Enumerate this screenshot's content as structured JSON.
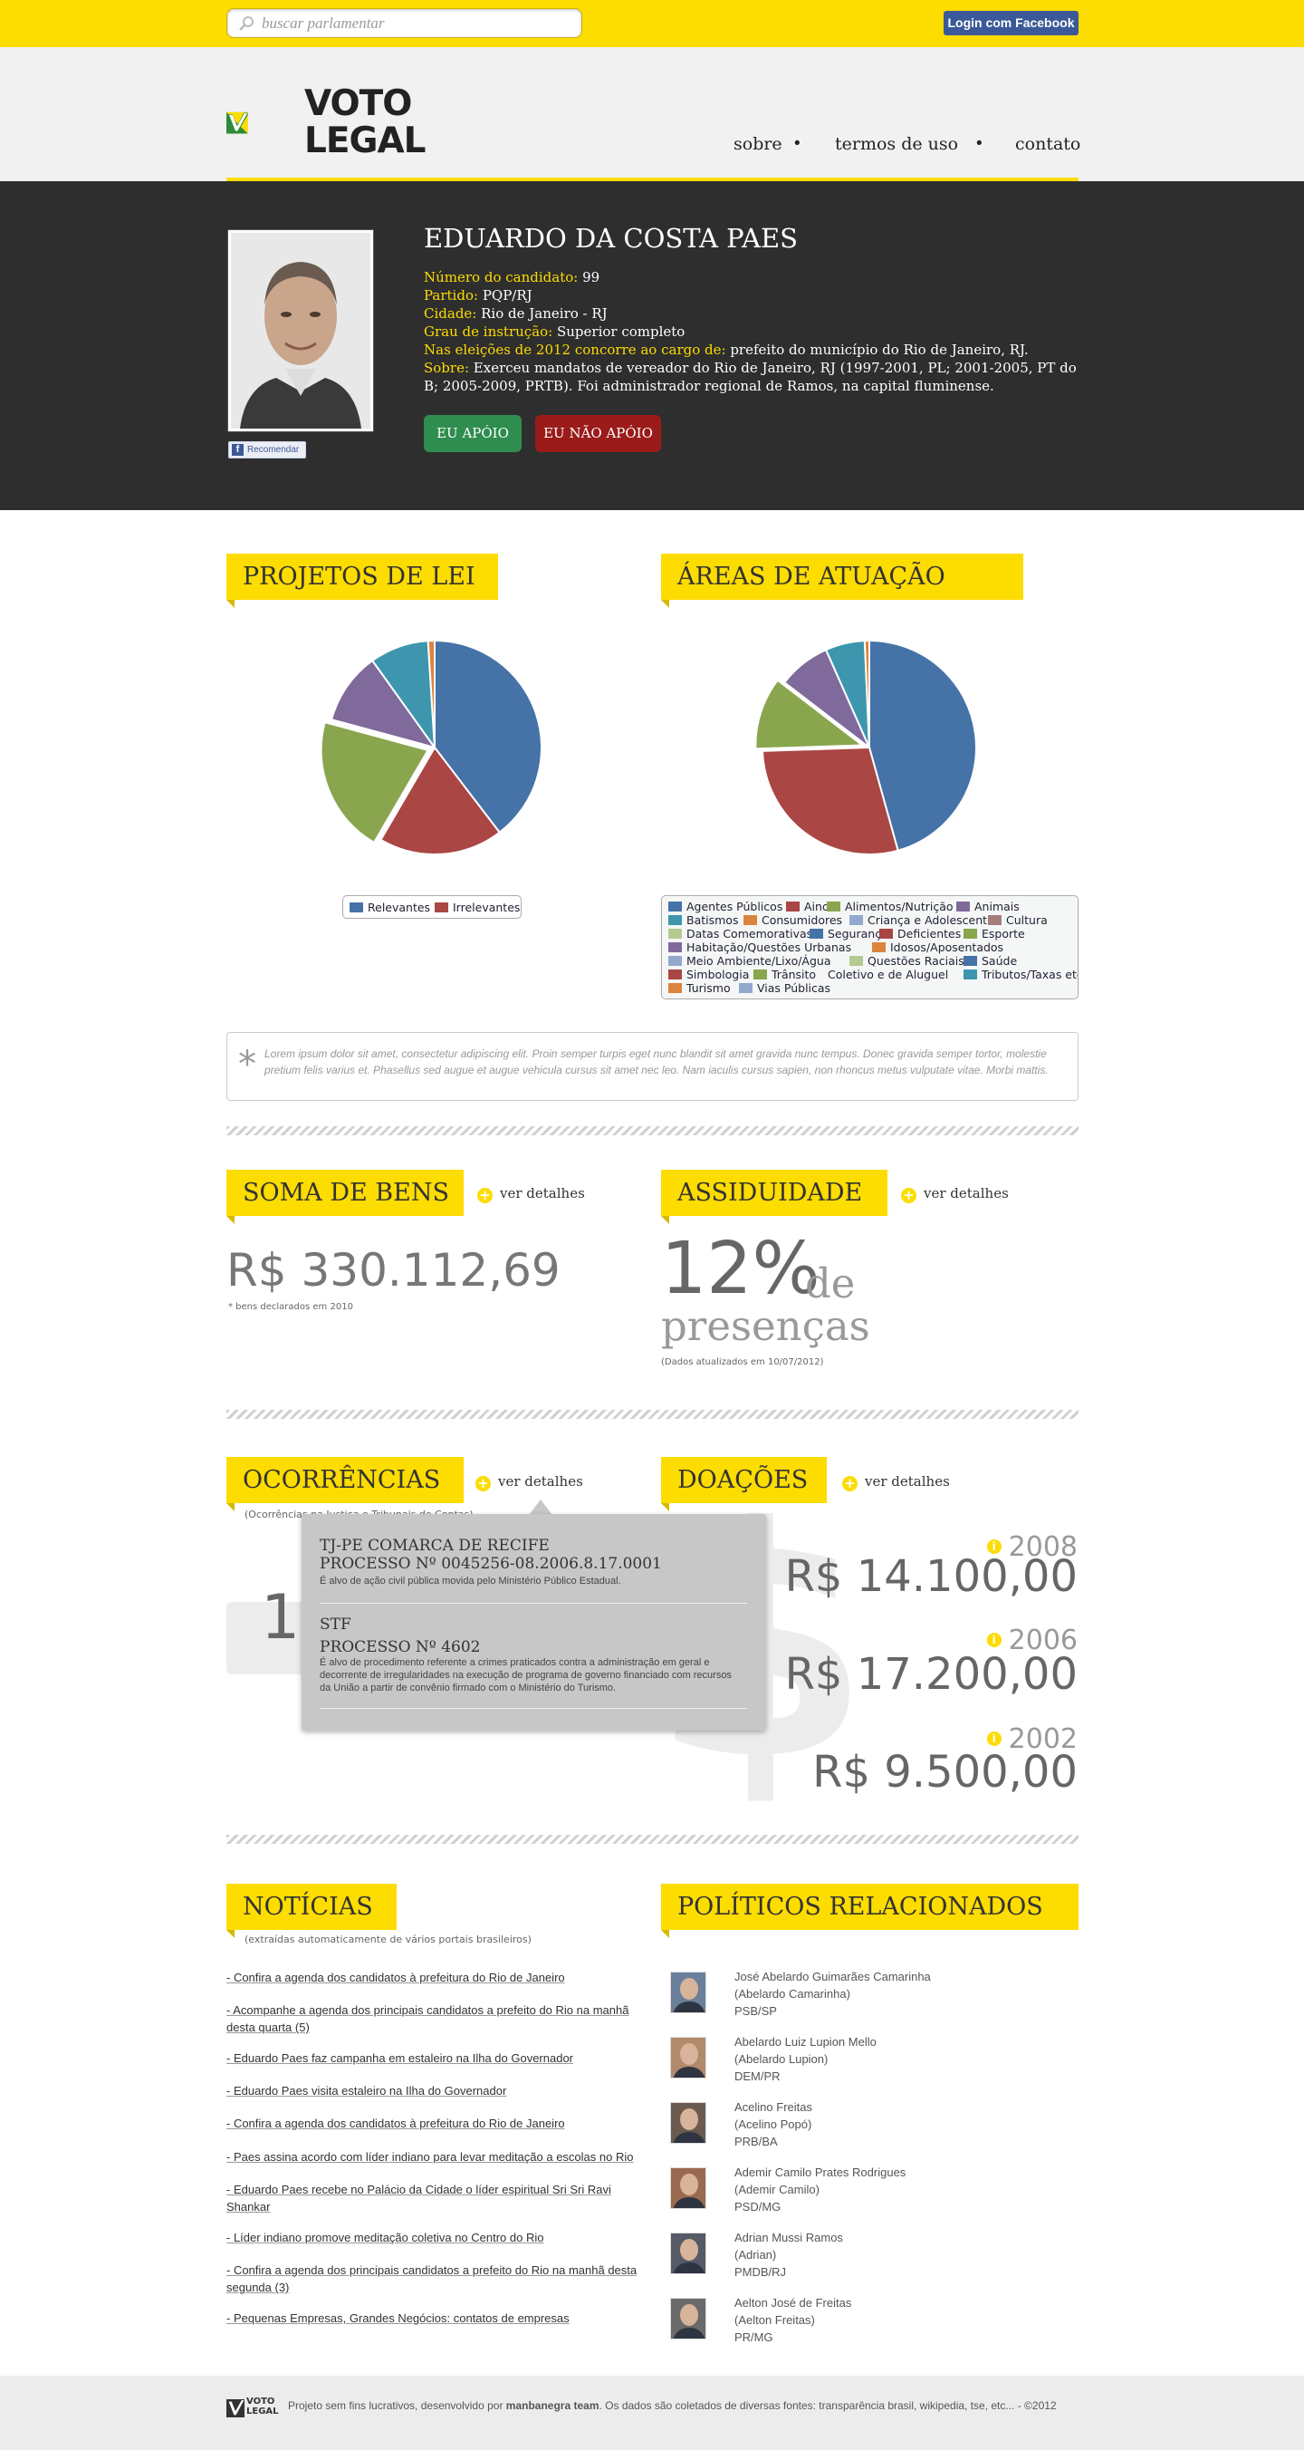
{
  "topbar": {
    "search_placeholder": "buscar parlamentar",
    "login_label": "Login com Facebook"
  },
  "header": {
    "logo_line1": "VOTO",
    "logo_line2": "LEGAL",
    "nav": [
      "sobre",
      "termos de uso",
      "contato"
    ]
  },
  "profile": {
    "name": "EDUARDO DA COSTA PAES",
    "recommend_label": "Recomendar",
    "fields": [
      {
        "label": "Número do candidato:",
        "value": "99"
      },
      {
        "label": "Partido:",
        "value": "PQP/RJ"
      },
      {
        "label": "Cidade:",
        "value": "Rio de Janeiro - RJ"
      },
      {
        "label": "Grau de instrução:",
        "value": "Superior completo"
      },
      {
        "label": "Nas eleições de 2012 concorre ao cargo de:",
        "value": "prefeito do município do Rio de Janeiro, RJ."
      },
      {
        "label": "Sobre:",
        "value": "Exerceu mandatos de vereador do Rio de Janeiro, RJ (1997-2001, PL; 2001-2005, PT do B; 2005-2009, PRTB). Foi administrador regional de Ramos, na capital fluminense."
      }
    ],
    "apoio_label": "EU APÓIO",
    "nao_apoio_label": "EU NÃO APÓIO"
  },
  "projetos": {
    "title": "PROJETOS DE LEI",
    "legend": [
      {
        "label": "Relevantes",
        "color": "#4572a7"
      },
      {
        "label": "Irrelevantes",
        "color": "#aa4643"
      }
    ]
  },
  "areas": {
    "title": "ÁREAS DE ATUAÇÃO",
    "legend": [
      {
        "label": "Agentes Públicos",
        "color": "#4572a7"
      },
      {
        "label": "Ainda",
        "color": "#aa4643"
      },
      {
        "label": "Alimentos/Nutrição",
        "color": "#89a54e"
      },
      {
        "label": "Animais",
        "color": "#80699b"
      },
      {
        "label": "Batismos",
        "color": "#3d96ae"
      },
      {
        "label": "Consumidores",
        "color": "#db843d"
      },
      {
        "label": "Criança e Adolescente",
        "color": "#92a8cd"
      },
      {
        "label": "Cultura",
        "color": "#a47d7c"
      },
      {
        "label": "Datas Comemorativas",
        "color": "#b5ca92"
      },
      {
        "label": "Segurança",
        "color": "#4572a7"
      },
      {
        "label": "Deficientes",
        "color": "#aa4643"
      },
      {
        "label": "Esporte",
        "color": "#89a54e"
      },
      {
        "label": "Habitação/Questões Urbanas",
        "color": "#80699b"
      },
      {
        "label": "Idosos/Aposentados",
        "color": "#db843d"
      },
      {
        "label": "Meio Ambiente/Lixo/Água",
        "color": "#92a8cd"
      },
      {
        "label": "Questões Raciais",
        "color": "#b5ca92"
      },
      {
        "label": "Saúde",
        "color": "#4572a7"
      },
      {
        "label": "Simbologia",
        "color": "#aa4643"
      },
      {
        "label": "Trânsito",
        "color": "#89a54e"
      },
      {
        "label": "Coletivo e de Aluguel",
        "color": "#ffffff"
      },
      {
        "label": "Tributos/Taxas etc.",
        "color": "#3d96ae"
      },
      {
        "label": "Turismo",
        "color": "#db843d"
      },
      {
        "label": "Vias Públicas",
        "color": "#92a8cd"
      }
    ]
  },
  "chart_data": [
    {
      "type": "pie",
      "title": "PROJETOS DE LEI",
      "slices": [
        {
          "label": "Relevantes",
          "value": 40,
          "color": "#4572a7"
        },
        {
          "label": "",
          "value": 19,
          "color": "#aa4643"
        },
        {
          "label": "",
          "value": 21,
          "color": "#89a54e"
        },
        {
          "label": "",
          "value": 11,
          "color": "#80699b"
        },
        {
          "label": "",
          "value": 9,
          "color": "#3d96ae"
        },
        {
          "label": "",
          "value": 1,
          "color": "#db843d"
        }
      ]
    },
    {
      "type": "pie",
      "title": "ÁREAS DE ATUAÇÃO",
      "slices": [
        {
          "label": "Agentes Públicos",
          "value": 46,
          "color": "#4572a7"
        },
        {
          "label": "",
          "value": 29,
          "color": "#aa4643"
        },
        {
          "label": "",
          "value": 11,
          "color": "#89a54e"
        },
        {
          "label": "",
          "value": 8,
          "color": "#80699b"
        },
        {
          "label": "",
          "value": 6,
          "color": "#3d96ae"
        },
        {
          "label": "",
          "value": 0.7,
          "color": "#db843d"
        }
      ]
    }
  ],
  "lorem": "Lorem ipsum dolor sit amet, consectetur adipiscing elit. Proin semper turpis eget nunc blandit sit amet gravida nunc tempus. Donec gravida semper tortor, molestie pretium felis varius et. Phasellus sed augue et augue vehicula cursus sit amet nec leo. Nam iaculis cursus sapien, non rhoncus metus vulputate vitae. Morbi mattis.",
  "bens": {
    "title": "SOMA DE BENS",
    "link": "ver detalhes",
    "value": "R$ 330.112,69",
    "note": "* bens declarados em 2010"
  },
  "assiduidade": {
    "title": "ASSIDUIDADE",
    "link": "ver detalhes",
    "percent": "12%",
    "de": "de",
    "presencas": "presenças",
    "note": "(Dados atualizados em 10/07/2012)"
  },
  "ocorrencias": {
    "title": "OCORRÊNCIAS",
    "link": "ver detalhes",
    "subtitle": "(Ocorrências na Justiça e Tribunais de Contas)",
    "count": "15",
    "items": [
      {
        "court": "TJ-PE COMARCA DE RECIFE",
        "process": "PROCESSO Nº 0045256-08.2006.8.17.0001",
        "desc": "É alvo de ação civil pública movida pelo Ministério Público Estadual."
      },
      {
        "court": "STF",
        "process": "PROCESSO Nº 4602",
        "desc": "É alvo de procedimento referente a crimes praticados contra a administração em geral e decorrente de irregularidades na execução de programa de governo financiado com recursos da União a partir de convênio firmado com o Ministério do Turismo."
      }
    ]
  },
  "doacoes": {
    "title": "DOAÇÕES",
    "link": "ver detalhes",
    "entries": [
      {
        "year": "2008",
        "amount": "R$ 14.100,00"
      },
      {
        "year": "2006",
        "amount": "R$ 17.200,00"
      },
      {
        "year": "2002",
        "amount": "R$ 9.500,00"
      }
    ]
  },
  "noticias": {
    "title": "NOTÍCIAS",
    "subtitle": "(extraídas automaticamente de vários portais brasileiros)",
    "items": [
      "- Confira a agenda dos candidatos à prefeitura do Rio de Janeiro",
      "- Acompanhe a agenda dos principais candidatos a prefeito do Rio na manhã desta quarta (5)",
      "- Eduardo Paes faz campanha em estaleiro na Ilha do Governador",
      "- Eduardo Paes visita estaleiro na Ilha do Governador",
      "- Confira a agenda dos candidatos à prefeitura do Rio de Janeiro",
      "- Paes assina acordo com líder indiano para levar meditação a escolas no Rio",
      "- Eduardo Paes recebe no Palácio da Cidade o líder espiritual Sri Sri Ravi Shankar",
      "- Líder indiano promove meditação coletiva no Centro do Rio",
      "- Confira a agenda dos principais candidatos a prefeito do Rio na manhã desta segunda (3)",
      "- Pequenas Empresas, Grandes Negócios: contatos de empresas"
    ]
  },
  "relacionados": {
    "title": "POLÍTICOS RELACIONADOS",
    "items": [
      {
        "name": "José Abelardo Guimarães Camarinha",
        "alias": "(Abelardo Camarinha)",
        "party": "PSB/SP"
      },
      {
        "name": "Abelardo Luiz Lupion Mello",
        "alias": "(Abelardo Lupion)",
        "party": "DEM/PR"
      },
      {
        "name": "Acelino Freitas",
        "alias": "(Acelino Popó)",
        "party": "PRB/BA"
      },
      {
        "name": "Ademir Camilo Prates Rodrigues",
        "alias": "(Ademir Camilo)",
        "party": "PSD/MG"
      },
      {
        "name": "Adrian Mussi Ramos",
        "alias": "(Adrian)",
        "party": "PMDB/RJ"
      },
      {
        "name": "Aelton José de Freitas",
        "alias": "(Aelton Freitas)",
        "party": "PR/MG"
      }
    ]
  },
  "footer": {
    "logo_line1": "VOTO",
    "logo_line2": "LEGAL",
    "text_before": "Projeto sem fins lucrativos, desenvolvido por ",
    "team": "manbanegra team",
    "text_after": ". Os dados são coletados de diversas fontes: transparência brasil, wikipedia, tse, etc... - ©2012"
  }
}
